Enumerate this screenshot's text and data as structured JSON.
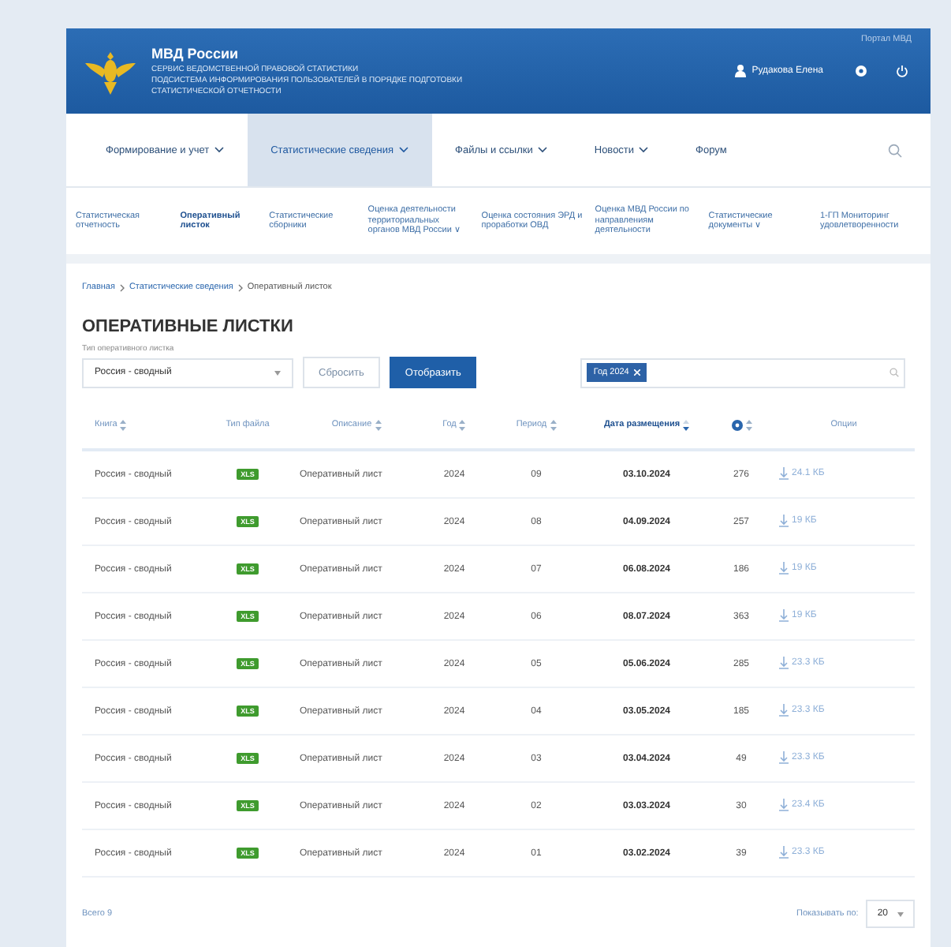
{
  "header": {
    "brand": "МВД России",
    "subtitle_lines": [
      "СЕРВИС ВЕДОМСТВЕННОЙ ПРАВОВОЙ СТАТИСТИКИ",
      "ПОДСИСТЕМА ИНФОРМИРОВАНИЯ ПОЛЬЗОВАТЕЛЕЙ В ПОРЯДКЕ ПОДГОТОВКИ",
      "СТАТИСТИЧЕСКОЙ ОТЧЕТНОСТИ"
    ],
    "portal_link": "Портал МВД",
    "user_name": "Рудакова Елена"
  },
  "nav": [
    {
      "label": "Формирование и учет",
      "dropdown": true,
      "selected": false
    },
    {
      "label": "Статистические сведения",
      "dropdown": true,
      "selected": true
    },
    {
      "label": "Файлы и ссылки",
      "dropdown": true,
      "selected": false
    },
    {
      "label": "Новости",
      "dropdown": true,
      "selected": false
    },
    {
      "label": "Форум",
      "dropdown": false,
      "selected": false
    }
  ],
  "subnav": [
    {
      "label": "Статистическая отчетность",
      "selected": false
    },
    {
      "label": "Оперативный листок",
      "selected": true
    },
    {
      "label": "Статистические сборники",
      "selected": false
    },
    {
      "label": "Оценка деятельности территориальных органов МВД России ∨",
      "selected": false
    },
    {
      "label": "Оценка состояния ЭРД и проработки ОВД",
      "selected": false
    },
    {
      "label": "Оценка МВД России по направлениям деятельности",
      "selected": false
    },
    {
      "label": "Статистические документы ∨",
      "selected": false
    },
    {
      "label": "1-ГП Мониторинг удовлетворенности",
      "selected": false
    }
  ],
  "breadcrumb": [
    "Главная",
    "Статистические сведения",
    "Оперативный листок"
  ],
  "title": "ОПЕРАТИВНЫЕ ЛИСТКИ",
  "filter": {
    "label": "Тип оперативного листка",
    "select_value": "Россия - сводный",
    "reset_button": "Сбросить",
    "apply_button": "Отобразить",
    "tags": [
      "Год 2024"
    ]
  },
  "table": {
    "columns": [
      {
        "kind": "text",
        "label": "Книга",
        "sortable": true,
        "sorted": false
      },
      {
        "kind": "text",
        "label": "Тип файла",
        "sortable": false,
        "sorted": false
      },
      {
        "kind": "text",
        "label": "Описание",
        "sortable": true,
        "sorted": false
      },
      {
        "kind": "text",
        "label": "Год",
        "sortable": true,
        "sorted": false
      },
      {
        "kind": "text",
        "label": "Период",
        "sortable": true,
        "sorted": false
      },
      {
        "kind": "text",
        "label": "Дата размещения",
        "sortable": true,
        "sorted": true
      },
      {
        "kind": "icon",
        "sortable": true,
        "sorted": false
      },
      {
        "kind": "text",
        "label": "Опции",
        "sortable": false,
        "sorted": false
      }
    ],
    "rows": [
      {
        "book": "Россия - сводный",
        "file_type": "XLS",
        "description": "Оперативный лист",
        "year": "2024",
        "period": "09",
        "date": "03.10.2024",
        "views": "276",
        "size": "24.1 КБ"
      },
      {
        "book": "Россия - сводный",
        "file_type": "XLS",
        "description": "Оперативный лист",
        "year": "2024",
        "period": "08",
        "date": "04.09.2024",
        "views": "257",
        "size": "19 КБ"
      },
      {
        "book": "Россия - сводный",
        "file_type": "XLS",
        "description": "Оперативный лист",
        "year": "2024",
        "period": "07",
        "date": "06.08.2024",
        "views": "186",
        "size": "19 КБ"
      },
      {
        "book": "Россия - сводный",
        "file_type": "XLS",
        "description": "Оперативный лист",
        "year": "2024",
        "period": "06",
        "date": "08.07.2024",
        "views": "363",
        "size": "19 КБ"
      },
      {
        "book": "Россия - сводный",
        "file_type": "XLS",
        "description": "Оперативный лист",
        "year": "2024",
        "period": "05",
        "date": "05.06.2024",
        "views": "285",
        "size": "23.3 КБ"
      },
      {
        "book": "Россия - сводный",
        "file_type": "XLS",
        "description": "Оперативный лист",
        "year": "2024",
        "period": "04",
        "date": "03.05.2024",
        "views": "185",
        "size": "23.3 КБ"
      },
      {
        "book": "Россия - сводный",
        "file_type": "XLS",
        "description": "Оперативный лист",
        "year": "2024",
        "period": "03",
        "date": "03.04.2024",
        "views": "49",
        "size": "23.3 КБ"
      },
      {
        "book": "Россия - сводный",
        "file_type": "XLS",
        "description": "Оперативный лист",
        "year": "2024",
        "period": "02",
        "date": "03.03.2024",
        "views": "30",
        "size": "23.4 КБ"
      },
      {
        "book": "Россия - сводный",
        "file_type": "XLS",
        "description": "Оперативный лист",
        "year": "2024",
        "period": "01",
        "date": "03.02.2024",
        "views": "39",
        "size": "23.3 КБ"
      }
    ]
  },
  "footer": {
    "total": "Всего 9",
    "per_page_label": "Показывать по:",
    "per_page_value": "20"
  }
}
